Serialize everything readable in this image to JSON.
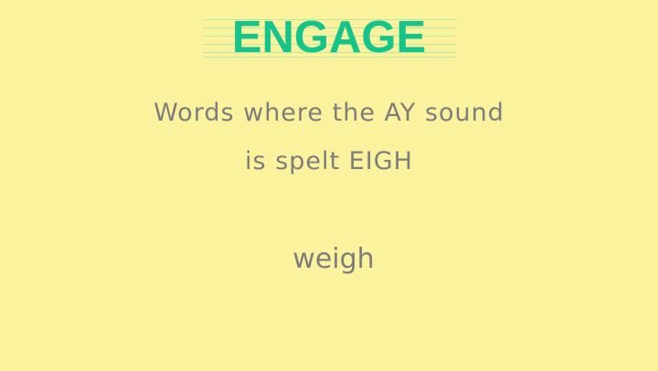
{
  "slide": {
    "title": "ENGAGE",
    "subtitle_line1": "Words where the AY sound",
    "subtitle_line2": "is spelt EIGH",
    "example_word": "weigh"
  },
  "colors": {
    "background": "#faf29c",
    "title": "#15c48a",
    "text": "#7d7d7d",
    "guide_lines": "#b9e7a4"
  }
}
